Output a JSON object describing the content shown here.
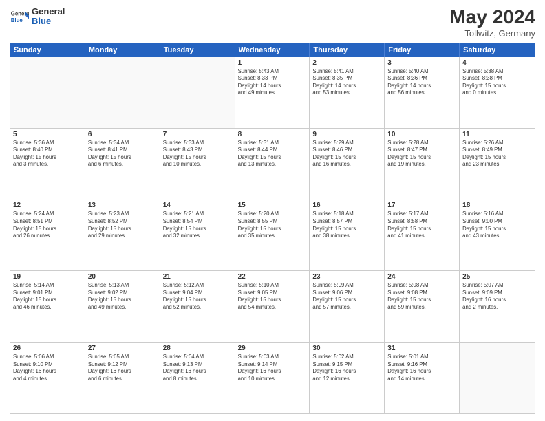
{
  "header": {
    "logo": {
      "general": "General",
      "blue": "Blue"
    },
    "month": "May 2024",
    "location": "Tollwitz, Germany"
  },
  "calendar": {
    "days": [
      "Sunday",
      "Monday",
      "Tuesday",
      "Wednesday",
      "Thursday",
      "Friday",
      "Saturday"
    ],
    "rows": [
      [
        {
          "day": "",
          "empty": true
        },
        {
          "day": "",
          "empty": true
        },
        {
          "day": "",
          "empty": true
        },
        {
          "day": "1",
          "lines": [
            "Sunrise: 5:43 AM",
            "Sunset: 8:33 PM",
            "Daylight: 14 hours",
            "and 49 minutes."
          ]
        },
        {
          "day": "2",
          "lines": [
            "Sunrise: 5:41 AM",
            "Sunset: 8:35 PM",
            "Daylight: 14 hours",
            "and 53 minutes."
          ]
        },
        {
          "day": "3",
          "lines": [
            "Sunrise: 5:40 AM",
            "Sunset: 8:36 PM",
            "Daylight: 14 hours",
            "and 56 minutes."
          ]
        },
        {
          "day": "4",
          "lines": [
            "Sunrise: 5:38 AM",
            "Sunset: 8:38 PM",
            "Daylight: 15 hours",
            "and 0 minutes."
          ]
        }
      ],
      [
        {
          "day": "5",
          "lines": [
            "Sunrise: 5:36 AM",
            "Sunset: 8:40 PM",
            "Daylight: 15 hours",
            "and 3 minutes."
          ]
        },
        {
          "day": "6",
          "lines": [
            "Sunrise: 5:34 AM",
            "Sunset: 8:41 PM",
            "Daylight: 15 hours",
            "and 6 minutes."
          ]
        },
        {
          "day": "7",
          "lines": [
            "Sunrise: 5:33 AM",
            "Sunset: 8:43 PM",
            "Daylight: 15 hours",
            "and 10 minutes."
          ]
        },
        {
          "day": "8",
          "lines": [
            "Sunrise: 5:31 AM",
            "Sunset: 8:44 PM",
            "Daylight: 15 hours",
            "and 13 minutes."
          ]
        },
        {
          "day": "9",
          "lines": [
            "Sunrise: 5:29 AM",
            "Sunset: 8:46 PM",
            "Daylight: 15 hours",
            "and 16 minutes."
          ]
        },
        {
          "day": "10",
          "lines": [
            "Sunrise: 5:28 AM",
            "Sunset: 8:47 PM",
            "Daylight: 15 hours",
            "and 19 minutes."
          ]
        },
        {
          "day": "11",
          "lines": [
            "Sunrise: 5:26 AM",
            "Sunset: 8:49 PM",
            "Daylight: 15 hours",
            "and 23 minutes."
          ]
        }
      ],
      [
        {
          "day": "12",
          "lines": [
            "Sunrise: 5:24 AM",
            "Sunset: 8:51 PM",
            "Daylight: 15 hours",
            "and 26 minutes."
          ]
        },
        {
          "day": "13",
          "lines": [
            "Sunrise: 5:23 AM",
            "Sunset: 8:52 PM",
            "Daylight: 15 hours",
            "and 29 minutes."
          ]
        },
        {
          "day": "14",
          "lines": [
            "Sunrise: 5:21 AM",
            "Sunset: 8:54 PM",
            "Daylight: 15 hours",
            "and 32 minutes."
          ]
        },
        {
          "day": "15",
          "lines": [
            "Sunrise: 5:20 AM",
            "Sunset: 8:55 PM",
            "Daylight: 15 hours",
            "and 35 minutes."
          ]
        },
        {
          "day": "16",
          "lines": [
            "Sunrise: 5:18 AM",
            "Sunset: 8:57 PM",
            "Daylight: 15 hours",
            "and 38 minutes."
          ]
        },
        {
          "day": "17",
          "lines": [
            "Sunrise: 5:17 AM",
            "Sunset: 8:58 PM",
            "Daylight: 15 hours",
            "and 41 minutes."
          ]
        },
        {
          "day": "18",
          "lines": [
            "Sunrise: 5:16 AM",
            "Sunset: 9:00 PM",
            "Daylight: 15 hours",
            "and 43 minutes."
          ]
        }
      ],
      [
        {
          "day": "19",
          "lines": [
            "Sunrise: 5:14 AM",
            "Sunset: 9:01 PM",
            "Daylight: 15 hours",
            "and 46 minutes."
          ]
        },
        {
          "day": "20",
          "lines": [
            "Sunrise: 5:13 AM",
            "Sunset: 9:02 PM",
            "Daylight: 15 hours",
            "and 49 minutes."
          ]
        },
        {
          "day": "21",
          "lines": [
            "Sunrise: 5:12 AM",
            "Sunset: 9:04 PM",
            "Daylight: 15 hours",
            "and 52 minutes."
          ]
        },
        {
          "day": "22",
          "lines": [
            "Sunrise: 5:10 AM",
            "Sunset: 9:05 PM",
            "Daylight: 15 hours",
            "and 54 minutes."
          ]
        },
        {
          "day": "23",
          "lines": [
            "Sunrise: 5:09 AM",
            "Sunset: 9:06 PM",
            "Daylight: 15 hours",
            "and 57 minutes."
          ]
        },
        {
          "day": "24",
          "lines": [
            "Sunrise: 5:08 AM",
            "Sunset: 9:08 PM",
            "Daylight: 15 hours",
            "and 59 minutes."
          ]
        },
        {
          "day": "25",
          "lines": [
            "Sunrise: 5:07 AM",
            "Sunset: 9:09 PM",
            "Daylight: 16 hours",
            "and 2 minutes."
          ]
        }
      ],
      [
        {
          "day": "26",
          "lines": [
            "Sunrise: 5:06 AM",
            "Sunset: 9:10 PM",
            "Daylight: 16 hours",
            "and 4 minutes."
          ]
        },
        {
          "day": "27",
          "lines": [
            "Sunrise: 5:05 AM",
            "Sunset: 9:12 PM",
            "Daylight: 16 hours",
            "and 6 minutes."
          ]
        },
        {
          "day": "28",
          "lines": [
            "Sunrise: 5:04 AM",
            "Sunset: 9:13 PM",
            "Daylight: 16 hours",
            "and 8 minutes."
          ]
        },
        {
          "day": "29",
          "lines": [
            "Sunrise: 5:03 AM",
            "Sunset: 9:14 PM",
            "Daylight: 16 hours",
            "and 10 minutes."
          ]
        },
        {
          "day": "30",
          "lines": [
            "Sunrise: 5:02 AM",
            "Sunset: 9:15 PM",
            "Daylight: 16 hours",
            "and 12 minutes."
          ]
        },
        {
          "day": "31",
          "lines": [
            "Sunrise: 5:01 AM",
            "Sunset: 9:16 PM",
            "Daylight: 16 hours",
            "and 14 minutes."
          ]
        },
        {
          "day": "",
          "empty": true
        }
      ]
    ]
  }
}
